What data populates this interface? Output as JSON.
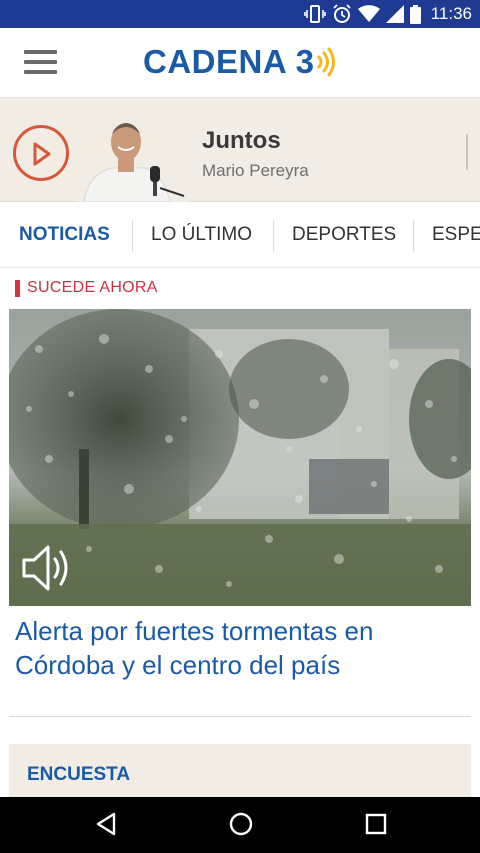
{
  "status_bar": {
    "time": "11:36",
    "icons": [
      "vibrate-icon",
      "alarm-icon",
      "wifi-icon",
      "signal-icon",
      "battery-icon"
    ]
  },
  "header": {
    "logo_text": "CADENA 3",
    "menu_icon": "hamburger-menu-icon",
    "colors": {
      "brand_blue": "#1a5aa6",
      "wave_yellow": "#f5b81c"
    }
  },
  "player": {
    "title": "Juntos",
    "host": "Mario Pereyra",
    "play_icon": "play-icon",
    "accent_color": "#d9563a"
  },
  "tabs": [
    {
      "label": "NOTICIAS",
      "active": true
    },
    {
      "label": "LO ÚLTIMO",
      "active": false
    },
    {
      "label": "DEPORTES",
      "active": false
    },
    {
      "label": "ESPE",
      "active": false
    }
  ],
  "main": {
    "section_label": "SUCEDE AHORA",
    "section_color": "#d6333f",
    "hero_icon": "speaker-icon",
    "headline": "Alerta por fuertes tormentas en Córdoba y el centro del país",
    "poll_title": "ENCUESTA"
  },
  "nav_bar": {
    "buttons": [
      "back-icon",
      "home-icon",
      "recents-icon"
    ]
  }
}
